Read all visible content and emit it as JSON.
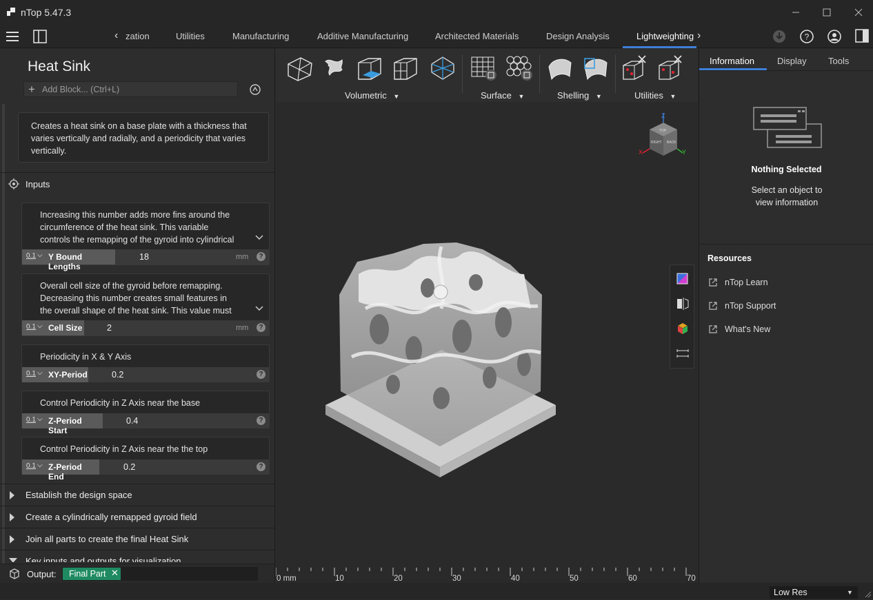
{
  "window": {
    "title": "nTop 5.47.3"
  },
  "ribbon": {
    "tabs": [
      "zation",
      "Utilities",
      "Manufacturing",
      "Additive Manufacturing",
      "Architected Materials",
      "Design Analysis",
      "Lightweighting"
    ],
    "active_tab": "Lightweighting"
  },
  "notebook": {
    "title": "Heat Sink",
    "add_block_placeholder": "Add Block... (Ctrl+L)",
    "description": "Creates a heat sink on a base plate with a thickness that varies vertically and radially, and a periodicity that varies vertically.",
    "inputs_label": "Inputs",
    "params": [
      {
        "desc": "Increasing this number adds more fins around the circumference of the heat sink. This variable controls the remapping of the gyroid into cylindrical",
        "type": "0.1",
        "name": "Y Bound Lengths",
        "value": "18",
        "unit": "mm"
      },
      {
        "desc": "Overall cell size of the gyroid before remapping. Decreasing this number creates small features in the overall shape of the heat sink. This value must",
        "type": "0.1",
        "name": "Cell Size",
        "value": "2",
        "unit": "mm"
      },
      {
        "desc": "Periodicity in X & Y Axis",
        "type": "0.1",
        "name": "XY-Period",
        "value": "0.2",
        "unit": ""
      },
      {
        "desc": "Control Periodicity in Z Axis near the base",
        "type": "0.1",
        "name": "Z-Period Start",
        "value": "0.4",
        "unit": ""
      },
      {
        "desc": "Control Periodicity in Z Axis near the the top",
        "type": "0.1",
        "name": "Z-Period End",
        "value": "0.2",
        "unit": ""
      }
    ],
    "sections": [
      "Establish the design space",
      "Create a cylindrically remapped gyroid field",
      "Join all parts to create the final Heat Sink",
      "Key inputs and outputs for visualization"
    ],
    "output_label": "Output:",
    "output_value": "Final Part"
  },
  "toolbar": {
    "groups": [
      "Volumetric",
      "Surface",
      "Shelling",
      "Utilities"
    ]
  },
  "viewport": {
    "ruler": [
      "0 mm",
      "10",
      "20",
      "30",
      "40",
      "50",
      "60",
      "70"
    ],
    "viewcube": {
      "axis_z": "Z",
      "axis_x": "X",
      "axis_y": "Y",
      "face_right": "RIGHT",
      "face_back": "BACK",
      "face_top": "TOP"
    }
  },
  "right_panel": {
    "tabs": [
      "Information",
      "Display",
      "Tools"
    ],
    "active_tab": "Information",
    "empty_title": "Nothing Selected",
    "empty_text": "Select an object to view information",
    "resources_label": "Resources",
    "links": [
      "nTop Learn",
      "nTop Support",
      "What's New"
    ]
  },
  "status": {
    "resolution": "Low Res"
  },
  "colors": {
    "accent": "#3e7fd8",
    "output_tag": "#1f8a62",
    "background": "#2b2b2b"
  }
}
